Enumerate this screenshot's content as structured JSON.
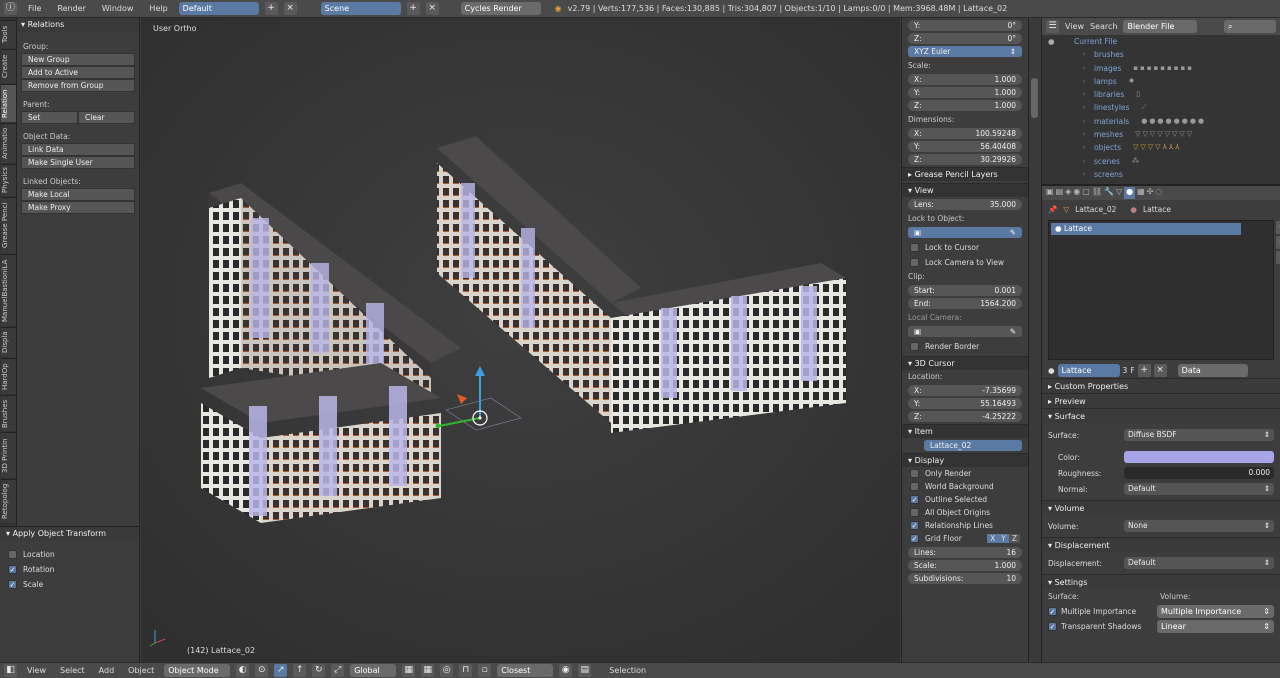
{
  "topbar": {
    "menus": [
      "File",
      "Render",
      "Window",
      "Help"
    ],
    "layout": "Default",
    "scene": "Scene",
    "engine": "Cycles Render",
    "stats": "v2.79 | Verts:177,536 | Faces:130,885 | Tris:304,807 | Objects:1/10 | Lamps:0/0 | Mem:3968.48M | Lattace_02"
  },
  "tabs": [
    "Tools",
    "Create",
    "Relation",
    "Animatio",
    "Physics",
    "Grease Penci",
    "ManuelBastioniLA",
    "Displa",
    "HardOp",
    "Brushes",
    "3D Printin",
    "Retopolog"
  ],
  "tools": {
    "header": "Relations",
    "group_label": "Group:",
    "group_buttons": [
      "New Group",
      "Add to Active",
      "Remove from Group"
    ],
    "parent_label": "Parent:",
    "parent_set": "Set",
    "parent_clear": "Clear",
    "objdata_label": "Object Data:",
    "objdata_buttons": [
      "Link Data",
      "Make Single User"
    ],
    "linked_label": "Linked Objects:",
    "linked_buttons": [
      "Make Local",
      "Make Proxy"
    ]
  },
  "apply": {
    "header": "Apply Object Transform",
    "items": [
      {
        "label": "Location",
        "on": false
      },
      {
        "label": "Rotation",
        "on": true
      },
      {
        "label": "Scale",
        "on": true
      }
    ]
  },
  "viewport": {
    "label": "User Ortho",
    "footer": "(142) Lattace_02"
  },
  "npanel": {
    "rot_y": "0°",
    "rot_z": "0°",
    "rot_mode": "XYZ Euler",
    "scale_label": "Scale:",
    "scale": {
      "x": "1.000",
      "y": "1.000",
      "z": "1.000"
    },
    "dim_label": "Dimensions:",
    "dim": {
      "x": "100.59248",
      "y": "56.40408",
      "z": "30.29926"
    },
    "gp": "Grease Pencil Layers",
    "view": "View",
    "lens_label": "Lens:",
    "lens": "35.000",
    "lock_label": "Lock to Object:",
    "lock_cursor": "Lock to Cursor",
    "lock_camera": "Lock Camera to View",
    "clip_label": "Clip:",
    "clip_start": "0.001",
    "clip_end": "1564.200",
    "start_label": "Start:",
    "end_label": "End:",
    "local_cam": "Local Camera:",
    "render_border": "Render Border",
    "cursor": "3D Cursor",
    "loc_label": "Location:",
    "cur": {
      "x": "-7.35699",
      "y": "55.16493",
      "z": "-4.25222"
    },
    "item": "Item",
    "item_name": "Lattace_02",
    "display": "Display",
    "only_render": "Only Render",
    "world_bg": "World Background",
    "outline_sel": "Outline Selected",
    "all_origins": "All Object Origins",
    "rel_lines": "Relationship Lines",
    "grid_floor": "Grid Floor",
    "lines_label": "Lines:",
    "lines": "16",
    "gscale_label": "Scale:",
    "gscale": "1.000",
    "subdiv_label": "Subdivisions:",
    "subdiv": "10"
  },
  "outliner": {
    "view": "View",
    "search": "Search",
    "mode": "Blender File",
    "items": [
      "Current File",
      "brushes",
      "images",
      "lamps",
      "libraries",
      "linestyles",
      "materials",
      "meshes",
      "objects",
      "scenes",
      "screens"
    ]
  },
  "props": {
    "obj": "Lattace_02",
    "mat": "Lattace",
    "slot": "Lattace",
    "matname": "Lattace",
    "users": "3",
    "fake": "F",
    "link": "Data",
    "custom": "Custom Properties",
    "preview": "Preview",
    "surface": "Surface",
    "surface_label": "Surface:",
    "surface_val": "Diffuse BSDF",
    "color_label": "Color:",
    "color": "#a8a5e8",
    "rough_label": "Roughness:",
    "rough": "0.000",
    "normal_label": "Normal:",
    "normal": "Default",
    "volume": "Volume",
    "volume_label": "Volume:",
    "volume_val": "None",
    "displacement": "Displacement",
    "disp_label": "Displacement:",
    "disp_val": "Default",
    "settings": "Settings",
    "s_surface": "Surface:",
    "s_volume": "Volume:",
    "mult_imp": "Multiple Importance",
    "vol_mult": "Multiple Importance",
    "trans_shadows": "Transparent Shadows",
    "linear": "Linear"
  },
  "bottombar": {
    "items": [
      "View",
      "Select",
      "Add",
      "Object"
    ],
    "mode": "Object Mode",
    "orient": "Global",
    "snap": "Closest",
    "selection": "Selection"
  }
}
